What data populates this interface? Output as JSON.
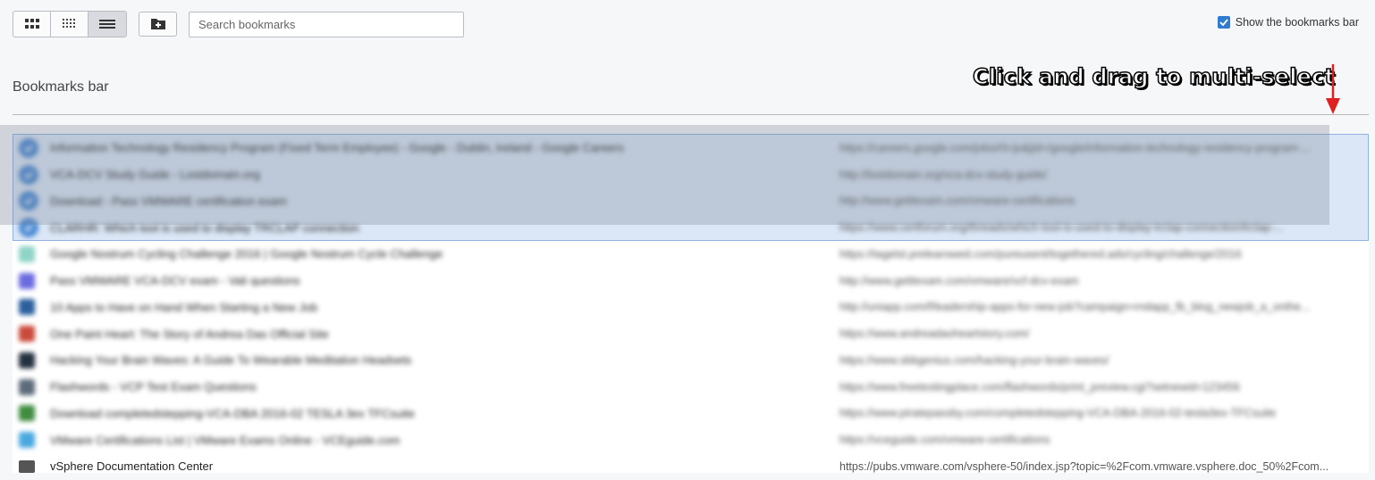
{
  "toolbar": {
    "view_buttons": [
      {
        "name": "large-grid-view",
        "active": false
      },
      {
        "name": "small-grid-view",
        "active": false
      },
      {
        "name": "list-view",
        "active": true
      }
    ],
    "search_placeholder": "Search bookmarks",
    "show_bar_label": "Show the bookmarks bar",
    "show_bar_checked": true
  },
  "section": {
    "title": "Bookmarks bar"
  },
  "annotation": {
    "text": "Click and drag to multi-select",
    "color": "#e02020"
  },
  "colors": {
    "accent": "#2f7bd1",
    "selection": "#dbe7f6"
  },
  "bookmarks": [
    {
      "title": "Information Technology Residency Program (Fixed Term Employee) - Google - Dublin, Ireland - Google Careers",
      "url": "https://careers.google.com/jobs#!t=jo&jid=/google/information-technology-residency-program-...",
      "selected": true,
      "icon": "check-favicon",
      "color": "#4a8ad4"
    },
    {
      "title": "VCA-DCV Study Guide - Lostdomain.org",
      "url": "http://lostdomain.org/vca-dcv-study-guide/",
      "selected": true,
      "icon": "check-favicon",
      "color": "#4a8ad4"
    },
    {
      "title": "Download - Pass VMWARE certification exam",
      "url": "http://www.getitexam.com/vmware-certifications",
      "selected": true,
      "icon": "check-favicon",
      "color": "#4a8ad4"
    },
    {
      "title": "CLARHR: Which tool is used to display TRCLAP connection",
      "url": "https://www.certforum.org/threads/which-tool-is-used-to-display-trclap-connection/trclap-...",
      "selected": true,
      "icon": "check-favicon",
      "color": "#4a8ad4"
    },
    {
      "title": "Google Nostrum Cycling Challenge 2016 | Google Nostrum Cycle Challenge",
      "url": "https://tagelst.prelearowed.com/pureusent/togethered.ads/cycling/challenge/2016",
      "selected": false,
      "icon": "leaf-favicon",
      "color": "#8ed3c7"
    },
    {
      "title": "Pass VMWARE VCA-DCV exam - Vali questions",
      "url": "http://www.getitexam.com/vmware/vcf-dcv-exam",
      "selected": false,
      "icon": "drop-favicon",
      "color": "#6b6be0"
    },
    {
      "title": "10 Apps to Have on Hand When Starting a New Job",
      "url": "http://uniapp.com/f/leadership-apps-for-new-job?campaign=rndapp_fb_blog_newjob_a_onthe...",
      "selected": false,
      "icon": "square-favicon",
      "color": "#2c5f9e"
    },
    {
      "title": "One Paint Heart: The Story of Andrea Das Official Site",
      "url": "https://www.andreadaoheartstory.com/",
      "selected": false,
      "icon": "star-favicon",
      "color": "#c94a3a"
    },
    {
      "title": "Hacking Your Brain Waves: A Guide To Wearable Meditation Headsets",
      "url": "https://www.sbbgenius.com/hacking-your-brain-waves/",
      "selected": false,
      "icon": "dark-favicon",
      "color": "#23303e"
    },
    {
      "title": "Flashwords - VCP Test Exam Questions",
      "url": "https://www.freetestingplace.com/flashwords/print_preview.cgi?setnewid=123456",
      "selected": false,
      "icon": "circle-favicon",
      "color": "#5c6a7a"
    },
    {
      "title": "Download completedstepping-VCA-DBA 2016-02 TESLA 3ex TFCsuite",
      "url": "https://www.piratepassby.com/completedstepping-VCA-DBA-2016-02-tesla3ex-TFCsuite",
      "selected": false,
      "icon": "film-favicon",
      "color": "#3f8c3f"
    },
    {
      "title": "VMware Certifications List | VMware Exams Online - VCEguide.com",
      "url": "https://vceguide.com/vmware-certifications",
      "selected": false,
      "icon": "blue-favicon",
      "color": "#4aa8e0"
    },
    {
      "title": "vSphere Documentation Center",
      "url": "https://pubs.vmware.com/vsphere-50/index.jsp?topic=%2Fcom.vmware.vsphere.doc_50%2Fcom...",
      "selected": false,
      "icon": "doc-favicon",
      "color": "#555555"
    }
  ]
}
